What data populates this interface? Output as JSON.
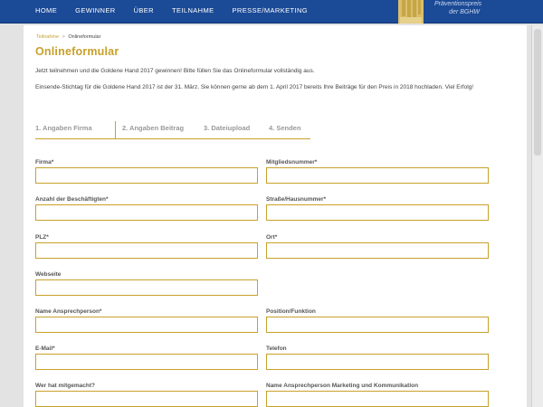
{
  "nav": {
    "items": [
      "HOME",
      "GEWINNER",
      "ÜBER",
      "TEILNAHME",
      "PRESSE/MARKETING"
    ]
  },
  "logo": {
    "line1": "Präventionspreis",
    "line2": "der BGHW"
  },
  "breadcrumb": {
    "parent": "Teilnahme",
    "separator": ">",
    "current": "Onlineformular"
  },
  "page": {
    "title": "Onlineformular",
    "intro1": "Jetzt teilnehmen und die Goldene Hand 2017 gewinnen! Bitte füllen Sie das Onlineformular vollständig aus.",
    "intro2": "Einsende-Stichtag für die Goldene Hand 2017 ist der 31. März. Sie können gerne ab dem 1. April 2017 bereits Ihre Beiträge für den Preis in 2018 hochladen. Viel Erfolg!"
  },
  "steps": [
    {
      "label": "1. Angaben Firma",
      "active": true
    },
    {
      "label": "2. Angaben Beitrag",
      "active": false
    },
    {
      "label": "3. Dateiupload",
      "active": false
    },
    {
      "label": "4. Senden",
      "active": false
    }
  ],
  "form": {
    "fields": [
      {
        "label": "Firma*",
        "value": ""
      },
      {
        "label": "Mitgliedsnummer*",
        "value": ""
      },
      {
        "label": "Anzahl der Beschäftigten*",
        "value": ""
      },
      {
        "label": "Straße/Hausnummer*",
        "value": ""
      },
      {
        "label": "PLZ*",
        "value": ""
      },
      {
        "label": "Ort*",
        "value": ""
      },
      {
        "label": "Webseite",
        "value": ""
      },
      {
        "label": "Name Ansprechperson*",
        "value": ""
      },
      {
        "label": "Position/Funktion",
        "value": ""
      },
      {
        "label": "E-Mail*",
        "value": ""
      },
      {
        "label": "Telefon",
        "value": ""
      },
      {
        "label": "Wer hat mitgemacht?",
        "value": ""
      },
      {
        "label": "Name Ansprechperson Marketing und Kommunikation",
        "value": ""
      }
    ]
  },
  "colors": {
    "nav_blue": "#1b4a96",
    "accent_gold": "#c8a12b",
    "background": "#e3e3e3"
  }
}
